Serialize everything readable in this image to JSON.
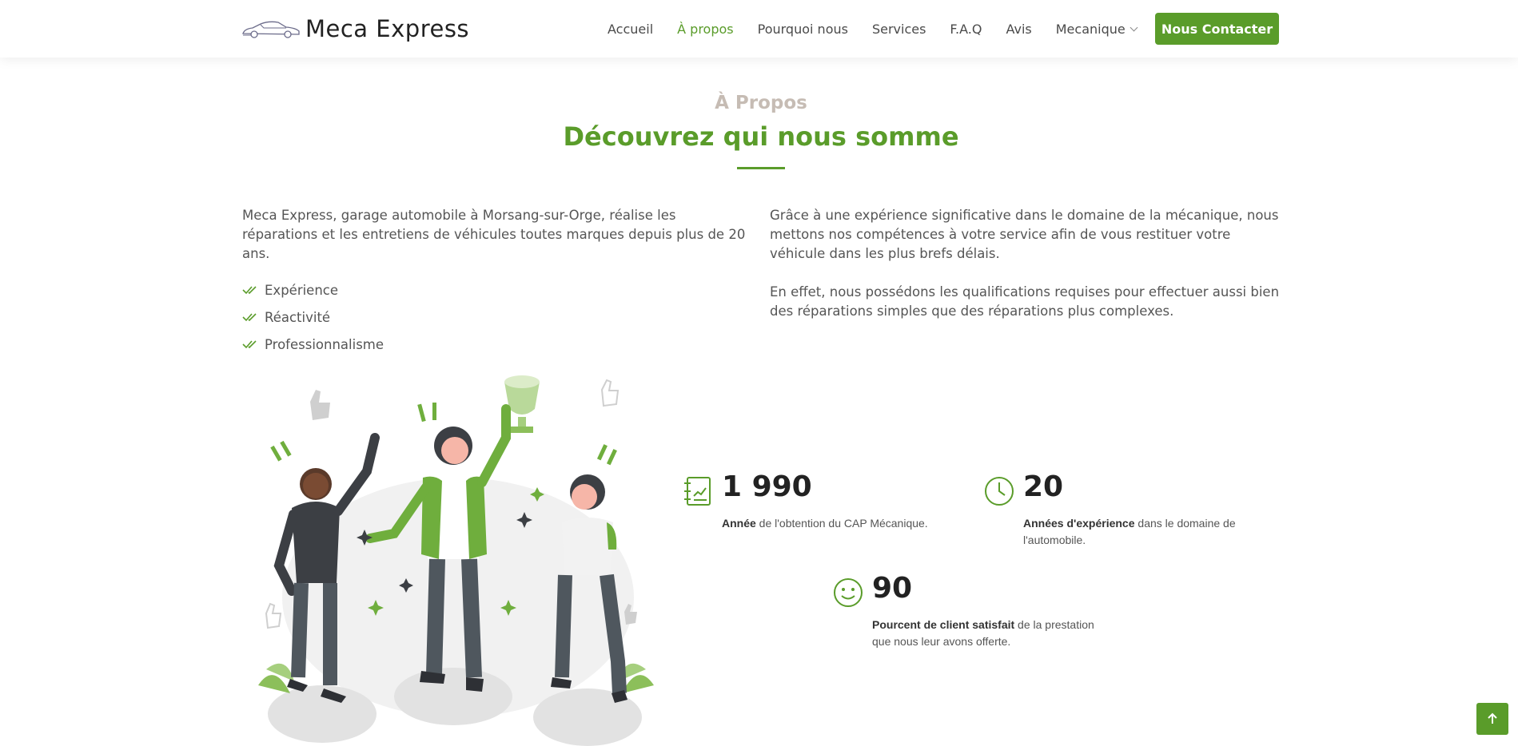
{
  "brand": {
    "name": "Meca Express"
  },
  "nav": {
    "items": [
      {
        "label": "Accueil",
        "active": false
      },
      {
        "label": "À propos",
        "active": true
      },
      {
        "label": "Pourquoi nous",
        "active": false
      },
      {
        "label": "Services",
        "active": false
      },
      {
        "label": "F.A.Q",
        "active": false
      },
      {
        "label": "Avis",
        "active": false
      },
      {
        "label": "Mecanique",
        "active": false,
        "dropdown": true
      }
    ],
    "cta": "Nous Contacter"
  },
  "section": {
    "eyebrow": "À Propos",
    "title": "Découvrez qui nous somme"
  },
  "about": {
    "left_paragraph": "Meca Express, garage automobile à Morsang-sur-Orge, réalise les réparations et les entretiens de véhicules toutes marques depuis plus de 20 ans.",
    "checklist": [
      "Expérience",
      "Réactivité",
      "Professionnalisme"
    ],
    "right_paragraphs": [
      "Grâce à une expérience significative dans le domaine de la mécanique, nous mettons nos compétences à votre service afin de vous restituer votre véhicule dans les plus brefs délais.",
      "En effet, nous possédons les qualifications requises pour effectuer aussi bien des réparations simples que des réparations plus complexes."
    ]
  },
  "stats": [
    {
      "icon": "document-chart-icon",
      "value": "1 990",
      "strong": "Année",
      "text": " de l'obtention du CAP Mécanique."
    },
    {
      "icon": "clock-icon",
      "value": "20",
      "strong": "Années d'expérience",
      "text": " dans le domaine de l'automobile."
    },
    {
      "icon": "smile-icon",
      "value": "90",
      "strong": "Pourcent de client satisfait",
      "text": " de la prestation que nous leur avons offerte."
    }
  ],
  "colors": {
    "accent": "#5a9c2a",
    "eyebrow": "#c6bcb4",
    "text": "#555555"
  }
}
